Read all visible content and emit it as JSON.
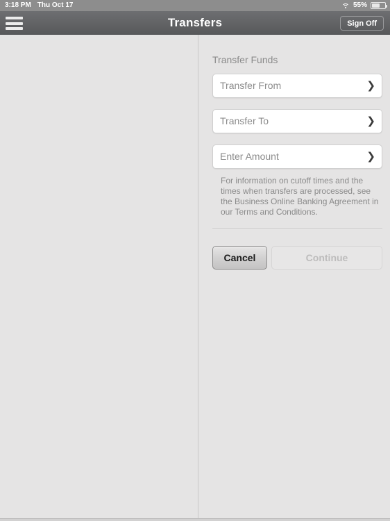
{
  "status_bar": {
    "time": "3:18 PM",
    "date": "Thu Oct 17",
    "wifi_icon": "wifi-icon",
    "battery_percent": "55%",
    "battery_icon": "battery-icon"
  },
  "nav_bar": {
    "menu_icon": "hamburger-menu-icon",
    "title": "Transfers",
    "sign_off_label": "Sign Off"
  },
  "form": {
    "section_title": "Transfer Funds",
    "fields": [
      {
        "label": "Transfer From",
        "chevron": "❯",
        "value": ""
      },
      {
        "label": "Transfer To",
        "chevron": "❯",
        "value": ""
      },
      {
        "label": "Enter Amount",
        "chevron": "❯",
        "value": ""
      }
    ],
    "disclaimer": "For information on cutoff times and the times when transfers are processed, see the Business Online Banking Agreement in our Terms and Conditions.",
    "cancel_label": "Cancel",
    "continue_label": "Continue"
  },
  "colors": {
    "background": "#e5e4e4",
    "navbar": "#636466",
    "statusbar": "#8d8d8d",
    "field_background": "#ffffff",
    "muted_text": "#8a8a8a"
  }
}
